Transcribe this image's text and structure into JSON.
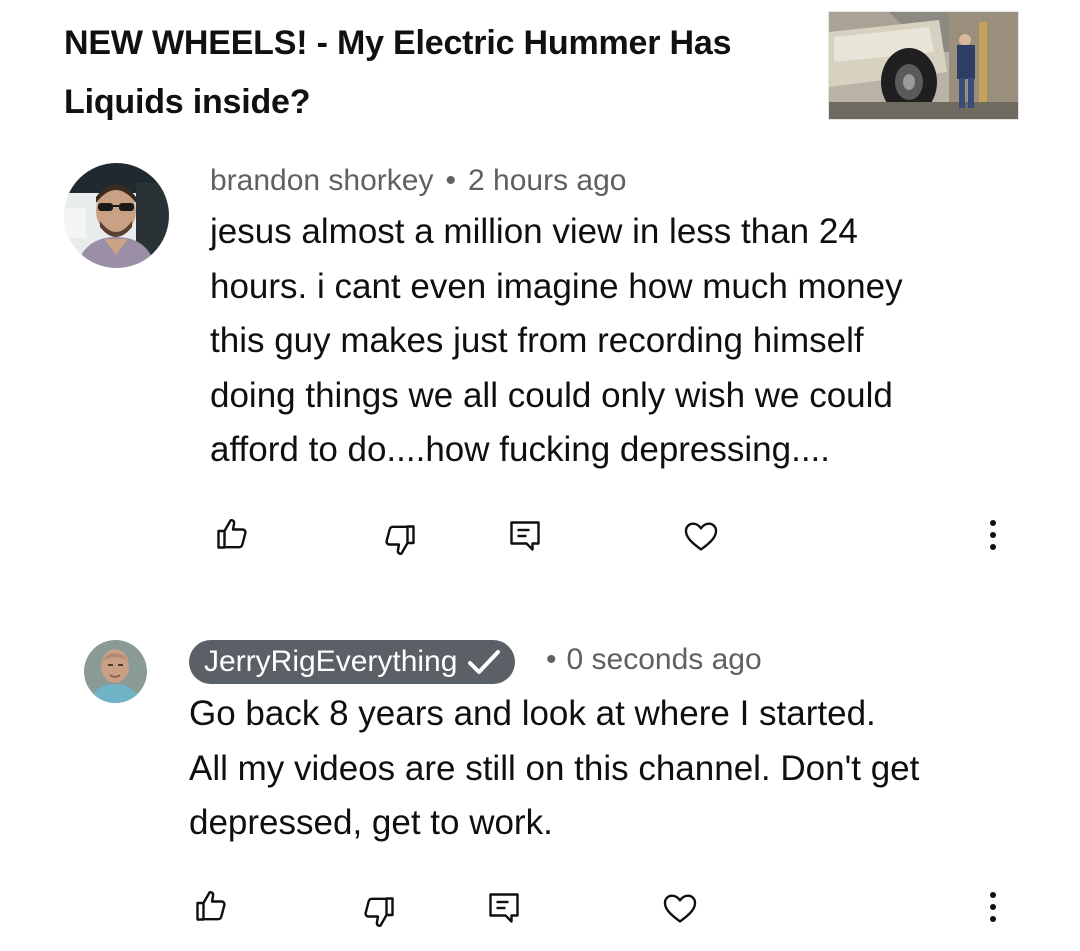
{
  "video": {
    "title_line1": "NEW WHEELS! - My Electric Hummer Has",
    "title_line2": "Liquids inside?"
  },
  "comments": [
    {
      "author": "brandon shorkey",
      "separator": "•",
      "time": "2 hours ago",
      "lines": [
        "jesus almost a million view in less than 24",
        "hours. i cant even imagine how much money",
        "this guy makes just from recording himself",
        "doing things we all could only wish we could",
        "afford to do....how fucking depressing...."
      ],
      "actions": [
        "like-icon",
        "dislike-icon",
        "reply-icon",
        "heart-icon",
        "more-vert-icon"
      ]
    },
    {
      "author": "JerryRigEverything",
      "author_verified": true,
      "separator": "•",
      "time": "0 seconds ago",
      "lines": [
        "Go back 8 years and look at where I started.",
        "All my videos are still on this channel. Don't get",
        "depressed, get to work."
      ],
      "actions": [
        "like-icon",
        "dislike-icon",
        "reply-icon",
        "heart-icon",
        "more-vert-icon"
      ]
    }
  ],
  "colors": {
    "creator_chip_bg": "#5b6067",
    "meta_text": "#606060",
    "icon": "#0f0f0f"
  }
}
